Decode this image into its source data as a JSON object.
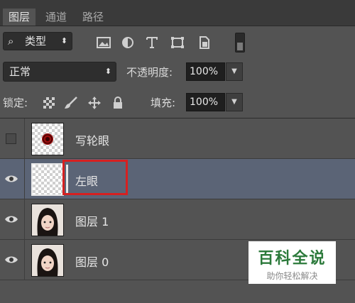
{
  "tabs": [
    {
      "label": "图层",
      "active": true
    },
    {
      "label": "通道",
      "active": false
    },
    {
      "label": "路径",
      "active": false
    }
  ],
  "filter": {
    "kind_label": "类型",
    "icons": [
      "image-filter-icon",
      "adjustment-filter-icon",
      "text-filter-icon",
      "shape-filter-icon",
      "smart-object-filter-icon"
    ]
  },
  "blend": {
    "mode": "正常",
    "opacity_label": "不透明度:",
    "opacity_value": "100%"
  },
  "lock": {
    "label": "锁定:",
    "fill_label": "填充:",
    "fill_value": "100%",
    "icons": [
      "lock-transparent-pixels-icon",
      "lock-image-pixels-icon",
      "lock-position-icon",
      "lock-all-icon"
    ]
  },
  "layers": [
    {
      "name": "写轮眼",
      "visible": false,
      "selected": false,
      "thumb": "red-dot"
    },
    {
      "name": "左眼",
      "visible": true,
      "selected": true,
      "thumb": "transparent"
    },
    {
      "name": "图层 1",
      "visible": true,
      "selected": false,
      "thumb": "portrait"
    },
    {
      "name": "图层 0",
      "visible": true,
      "selected": false,
      "thumb": "portrait"
    }
  ],
  "watermark": {
    "title": "百科全说",
    "subtitle": "助你轻松解决"
  },
  "colors": {
    "panel_bg": "#535353",
    "selected_row": "#5b6476",
    "highlight_box": "#d62020",
    "watermark_green": "#2c7a3b"
  }
}
